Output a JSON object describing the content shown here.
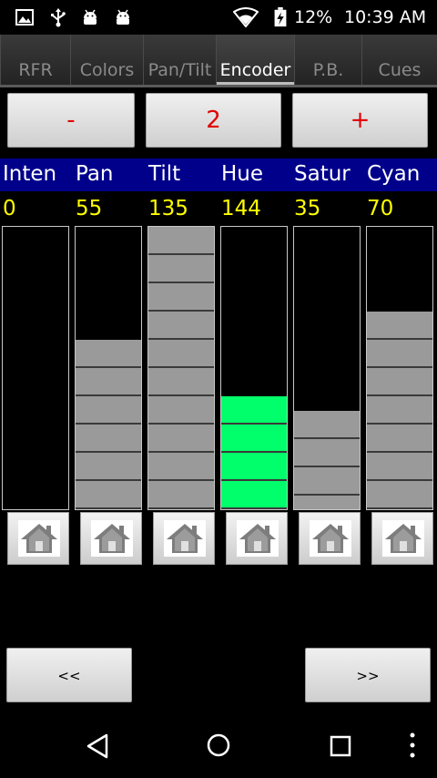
{
  "status_bar": {
    "battery": "12%",
    "time": "10:39 AM",
    "icons": [
      "image-icon",
      "usb-icon",
      "android-icon",
      "android-icon",
      "wifi-icon",
      "battery-charging-icon"
    ]
  },
  "tabs": [
    {
      "label": "RFR",
      "active": false
    },
    {
      "label": "Colors",
      "active": false
    },
    {
      "label": "Pan/Tilt",
      "active": false
    },
    {
      "label": "Encoder",
      "active": true
    },
    {
      "label": "P.B.",
      "active": false
    },
    {
      "label": "Cues",
      "active": false
    }
  ],
  "page_controls": {
    "minus_label": "-",
    "page_number": "2",
    "plus_label": "+"
  },
  "channels": [
    {
      "name": "Inten",
      "value": "0",
      "level": 0,
      "fill_color": "#9a9a9a"
    },
    {
      "name": "Pan",
      "value": "55",
      "level": 0.6,
      "fill_color": "#9a9a9a"
    },
    {
      "name": "Tilt",
      "value": "135",
      "level": 1.0,
      "fill_color": "#9a9a9a"
    },
    {
      "name": "Hue",
      "value": "144",
      "level": 0.4,
      "fill_color": "#00ff6a"
    },
    {
      "name": "Satur",
      "value": "35",
      "level": 0.35,
      "fill_color": "#9a9a9a"
    },
    {
      "name": "Cyan",
      "value": "70",
      "level": 0.7,
      "fill_color": "#9a9a9a"
    }
  ],
  "nav": {
    "prev_label": "<<",
    "next_label": ">>"
  },
  "colors": {
    "header_bg": "#00008b",
    "value_text": "#ffff00",
    "button_text": "#e00000"
  }
}
